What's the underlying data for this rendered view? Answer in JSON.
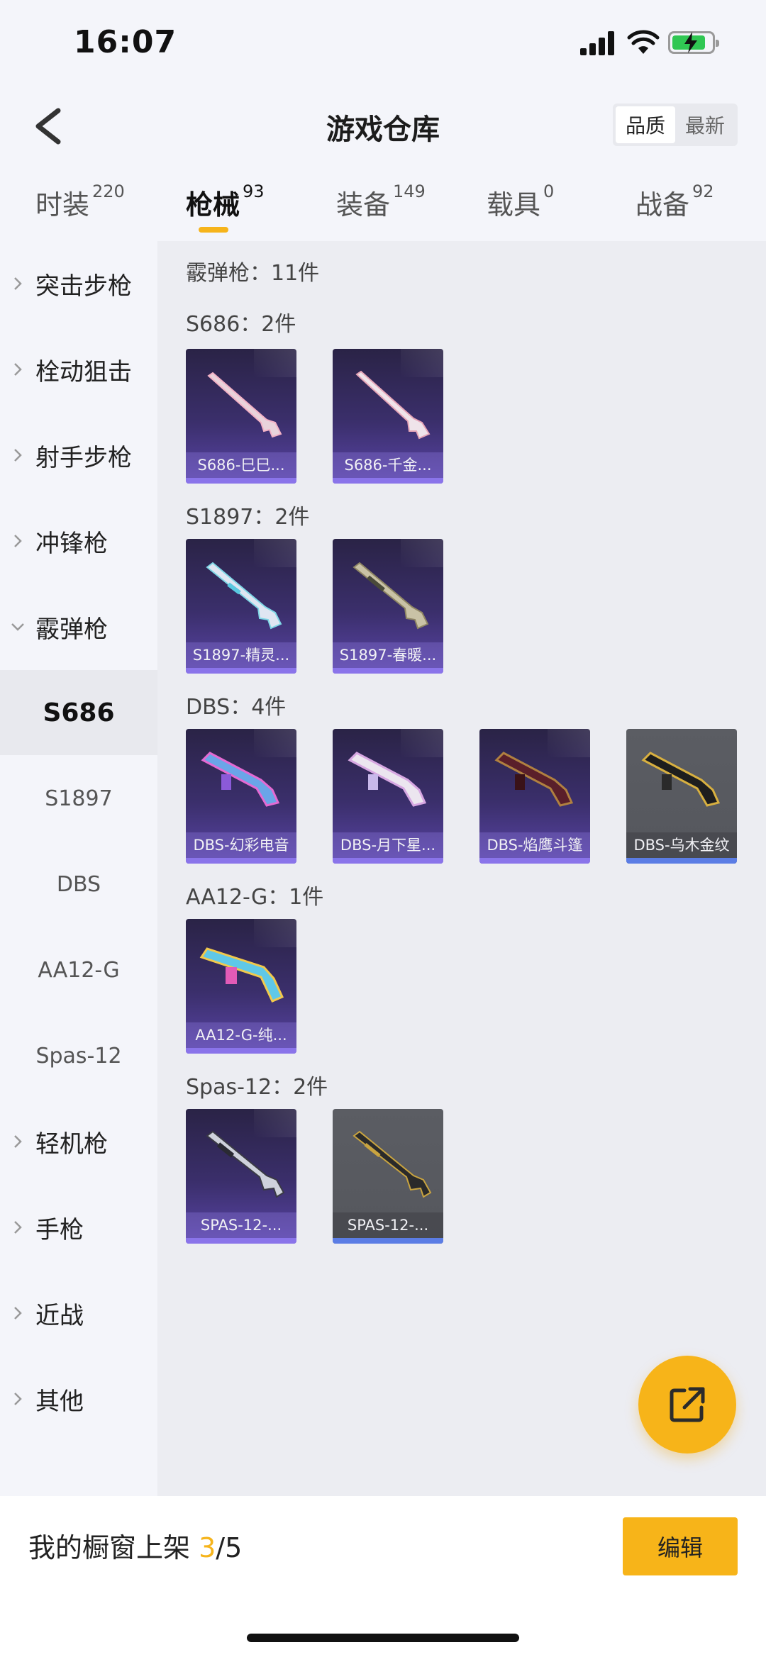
{
  "status": {
    "time": "16:07"
  },
  "header": {
    "title": "游戏仓库",
    "sort_quality": "品质",
    "sort_newest": "最新"
  },
  "tabs": [
    {
      "label": "时装",
      "count": "220"
    },
    {
      "label": "枪械",
      "count": "93"
    },
    {
      "label": "装备",
      "count": "149"
    },
    {
      "label": "载具",
      "count": "0"
    },
    {
      "label": "战备",
      "count": "92"
    }
  ],
  "sidebar": {
    "items": [
      {
        "label": "突击步枪"
      },
      {
        "label": "栓动狙击"
      },
      {
        "label": "射手步枪"
      },
      {
        "label": "冲锋枪"
      },
      {
        "label": "霰弹枪"
      },
      {
        "label": "轻机枪"
      },
      {
        "label": "手枪"
      },
      {
        "label": "近战"
      },
      {
        "label": "其他"
      }
    ],
    "subitems": [
      {
        "label": "S686"
      },
      {
        "label": "S1897"
      },
      {
        "label": "DBS"
      },
      {
        "label": "AA12-G"
      },
      {
        "label": "Spas-12"
      }
    ]
  },
  "content": {
    "category_title": "霰弹枪：11件",
    "sections": [
      {
        "title": "S686：2件",
        "items": [
          {
            "name": "S686-巳巳..."
          },
          {
            "name": "S686-千金..."
          }
        ]
      },
      {
        "title": "S1897：2件",
        "items": [
          {
            "name": "S1897-精灵..."
          },
          {
            "name": "S1897-春暖..."
          }
        ]
      },
      {
        "title": "DBS：4件",
        "items": [
          {
            "name": "DBS-幻彩电音"
          },
          {
            "name": "DBS-月下星..."
          },
          {
            "name": "DBS-焰鹰斗篷"
          },
          {
            "name": "DBS-乌木金纹"
          }
        ]
      },
      {
        "title": "AA12-G：1件",
        "items": [
          {
            "name": "AA12-G-纯..."
          }
        ]
      },
      {
        "title": "Spas-12：2件",
        "items": [
          {
            "name": "SPAS-12-..."
          },
          {
            "name": "SPAS-12-..."
          }
        ]
      }
    ]
  },
  "bottom": {
    "shelf_prefix": "我的橱窗上架 ",
    "shelf_count": "3",
    "shelf_total": "/5",
    "edit_label": "编辑"
  },
  "colors": {
    "accent": "#f7b419",
    "card_purple": "#3b2f6c",
    "card_grey": "#55575d"
  }
}
